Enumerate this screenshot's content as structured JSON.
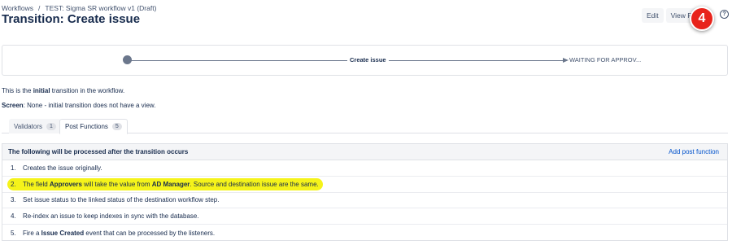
{
  "breadcrumb": {
    "root": "Workflows",
    "separator": "/",
    "workflow": "TEST: Sigma SR workflow v1 (Draft)"
  },
  "page_title": "Transition: Create issue",
  "toolbar": {
    "edit_label": "Edit",
    "view_label": "View Pr",
    "help_glyph": "?"
  },
  "annotation": {
    "step_number": "4",
    "color": "#e8231b"
  },
  "diagram": {
    "transition_label": "Create issue",
    "target_status": "WAITING FOR APPROV..."
  },
  "info": {
    "intro_prefix": "This is the ",
    "intro_bold": "initial",
    "intro_suffix": " transition in the workflow.",
    "screen_label": "Screen",
    "screen_text": ": None - initial transition does not have a view."
  },
  "tabs": [
    {
      "label": "Validators",
      "count": "1"
    },
    {
      "label": "Post Functions",
      "count": "5",
      "active": true
    }
  ],
  "post_functions": {
    "header": "The following will be processed after the transition occurs",
    "add_label": "Add post function",
    "items": [
      {
        "num": "1.",
        "a": "Creates the issue originally."
      },
      {
        "num": "2.",
        "a": "The field ",
        "b": "Approvers",
        "c": " will take the value from ",
        "d": "AD Manager",
        "e": ". Source and destination issue are the same.",
        "highlight": "#f5f31a"
      },
      {
        "num": "3.",
        "a": "Set issue status to the linked status of the destination workflow step."
      },
      {
        "num": "4.",
        "a": "Re-index an issue to keep indexes in sync with the database."
      },
      {
        "num": "5.",
        "a": "Fire a ",
        "b": "Issue Created",
        "c": " event that can be processed by the listeners."
      }
    ]
  },
  "colors": {
    "link": "#0052cc",
    "text": "#172b4d",
    "muted": "#42526e",
    "border": "#dfe1e6"
  }
}
